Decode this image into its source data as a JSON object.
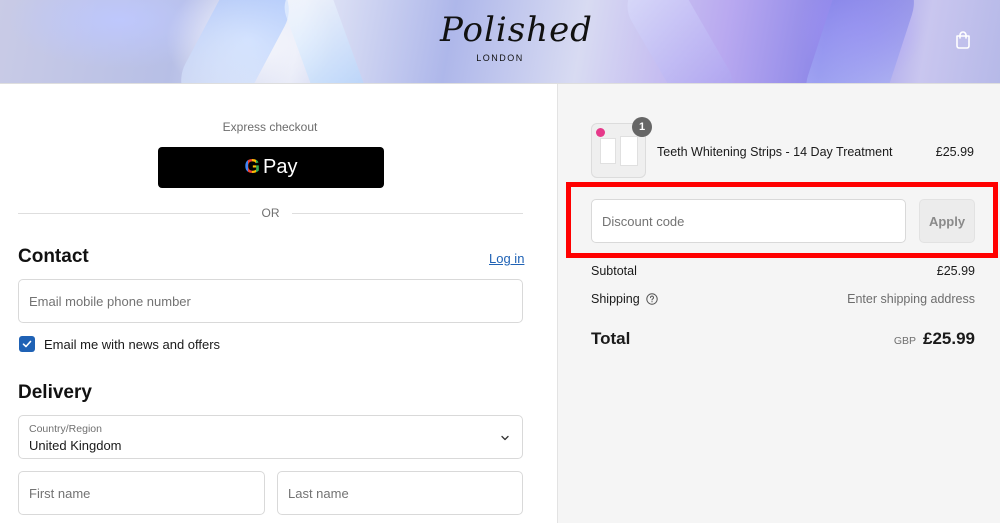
{
  "header": {
    "logo_script": "Polished",
    "logo_sub": "LONDON"
  },
  "express": {
    "label": "Express checkout",
    "gpay_g": "G",
    "gpay_pay": "Pay",
    "or_text": "OR"
  },
  "contact": {
    "title": "Contact",
    "login_link": "Log in",
    "email_placeholder": "Email mobile phone number",
    "newsletter_label": "Email me with news and offers",
    "newsletter_checked": true
  },
  "delivery": {
    "title": "Delivery",
    "country_label": "Country/Region",
    "country_value": "United Kingdom",
    "first_name_placeholder": "First name",
    "last_name_placeholder": "Last name"
  },
  "summary": {
    "item": {
      "name": "Teeth Whitening Strips - 14 Day Treatment",
      "price": "£25.99",
      "quantity": "1"
    },
    "discount_placeholder": "Discount code",
    "apply_label": "Apply",
    "subtotal_label": "Subtotal",
    "subtotal_value": "£25.99",
    "shipping_label": "Shipping",
    "shipping_value": "Enter shipping address",
    "total_label": "Total",
    "currency": "GBP",
    "total_value": "£25.99"
  },
  "colors": {
    "accent": "#1f62b5",
    "highlight": "#ff0000",
    "gpay_bg": "#000000"
  }
}
